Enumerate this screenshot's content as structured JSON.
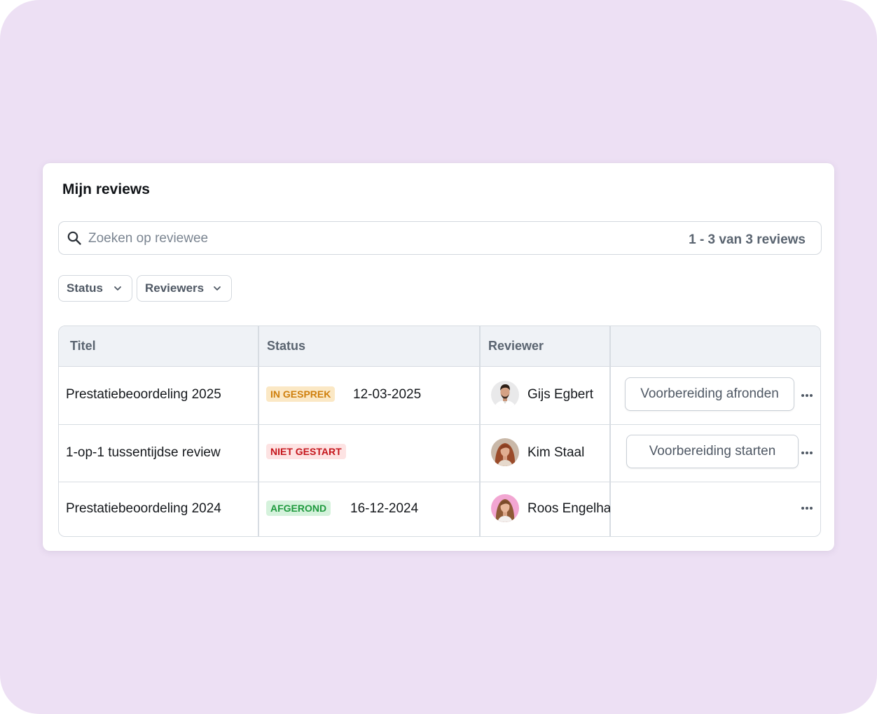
{
  "card": {
    "title": "Mijn reviews"
  },
  "search": {
    "placeholder": "Zoeken op reviewee",
    "value": "",
    "result_count": "1 - 3 van 3 reviews"
  },
  "filters": [
    {
      "label": "Status"
    },
    {
      "label": "Reviewers"
    }
  ],
  "table": {
    "columns": [
      "Titel",
      "Status",
      "Reviewer",
      ""
    ],
    "rows": [
      {
        "title": "Prestatiebeoordeling 2025",
        "status": "IN GESPREK",
        "status_color": "#cf7f0c",
        "date": "12-03-2025",
        "reviewer": "Gijs Egbert",
        "action": "Voorbereiding afronden"
      },
      {
        "title": "1-op-1 tussentijdse review",
        "status": "NIET GESTART",
        "status_color": "#c5161c",
        "date": "",
        "reviewer": "Kim Staal",
        "action": "Voorbereiding starten"
      },
      {
        "title": "Prestatiebeoordeling 2024",
        "status": "AFGEROND",
        "status_color": "#1f9a3e",
        "date": "16-12-2024",
        "reviewer": "Roos Engelhart",
        "action": ""
      }
    ]
  },
  "icons": {
    "search": "search-icon",
    "chevron": "chevron-down-icon",
    "more": "more-horizontal-icon"
  },
  "colors": {
    "background": "#ede0f4",
    "card": "#ffffff",
    "header_bg": "#eff2f6",
    "border": "#d7dce2"
  }
}
